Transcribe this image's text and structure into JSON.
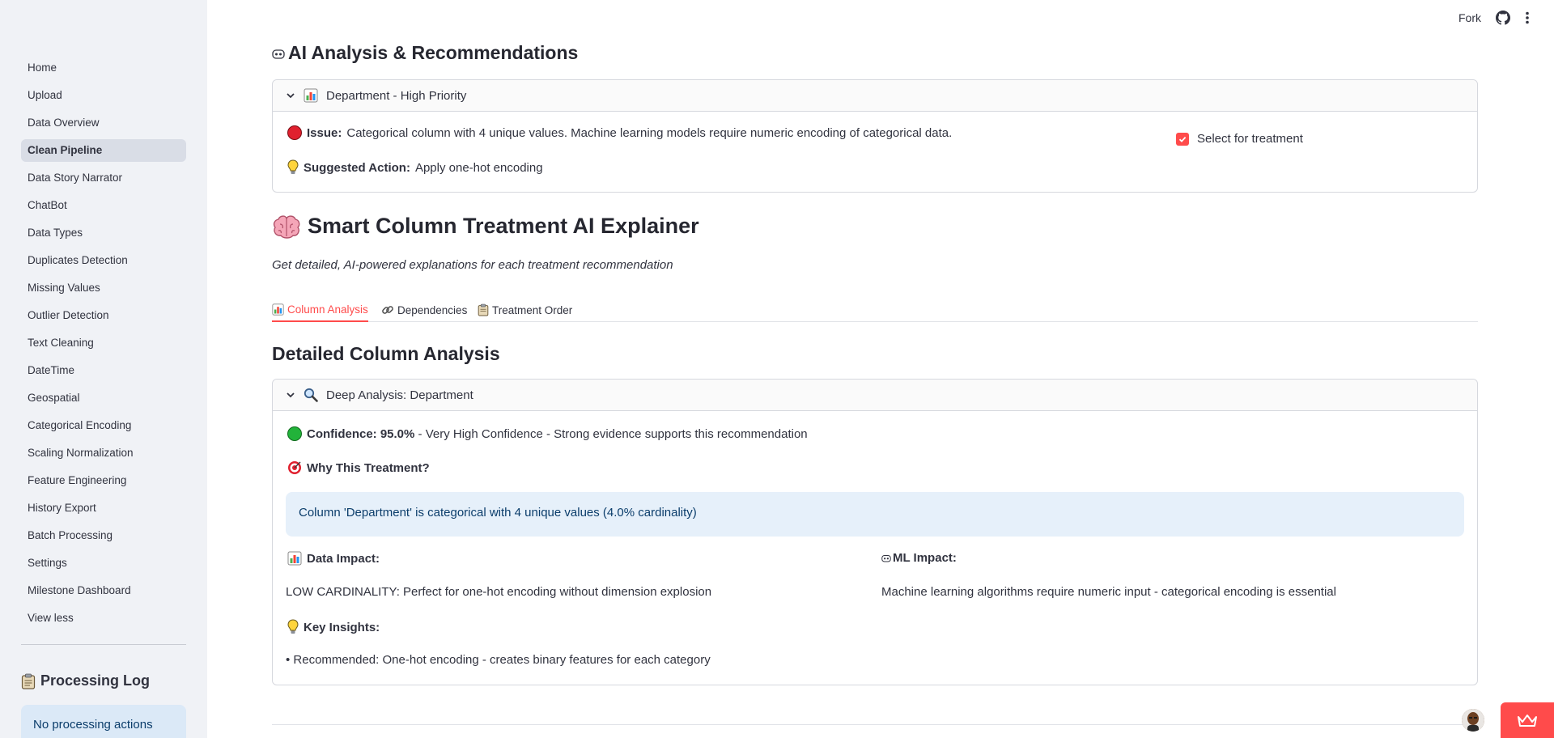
{
  "sidebar": {
    "items": [
      {
        "label": "Home"
      },
      {
        "label": "Upload"
      },
      {
        "label": "Data Overview"
      },
      {
        "label": "Clean Pipeline",
        "active": true
      },
      {
        "label": "Data Story Narrator"
      },
      {
        "label": "ChatBot"
      },
      {
        "label": "Data Types"
      },
      {
        "label": "Duplicates Detection"
      },
      {
        "label": "Missing Values"
      },
      {
        "label": "Outlier Detection"
      },
      {
        "label": "Text Cleaning"
      },
      {
        "label": "DateTime"
      },
      {
        "label": "Geospatial"
      },
      {
        "label": "Categorical Encoding"
      },
      {
        "label": "Scaling Normalization"
      },
      {
        "label": "Feature Engineering"
      },
      {
        "label": "History Export"
      },
      {
        "label": "Batch Processing"
      },
      {
        "label": "Settings"
      },
      {
        "label": "Milestone Dashboard"
      }
    ],
    "view_less": "View less",
    "processing_log": {
      "title": "Processing Log",
      "message": "No processing actions"
    }
  },
  "header": {
    "fork": "Fork"
  },
  "ai_analysis": {
    "title": "AI Analysis & Recommendations",
    "expander_title": "Department - High Priority",
    "issue_label": "Issue:",
    "issue_text": "Categorical column with 4 unique values. Machine learning models require numeric encoding of categorical data.",
    "action_label": "Suggested Action:",
    "action_text": "Apply one-hot encoding",
    "checkbox_label": "Select for treatment",
    "checkbox_checked": true
  },
  "explainer": {
    "title": "Smart Column Treatment AI Explainer",
    "subtitle": "Get detailed, AI-powered explanations for each treatment recommendation",
    "tabs": [
      {
        "label": "Column Analysis",
        "active": true
      },
      {
        "label": "Dependencies"
      },
      {
        "label": "Treatment Order"
      }
    ]
  },
  "detailed": {
    "title": "Detailed Column Analysis",
    "expander_title": "Deep Analysis: Department",
    "confidence_label": "Confidence: 95.0%",
    "confidence_text": " - Very High Confidence - Strong evidence supports this recommendation",
    "why_label": "Why This Treatment?",
    "why_text": "Column 'Department' is categorical with 4 unique values (4.0% cardinality)",
    "data_impact_label": "Data Impact:",
    "data_impact_text": "LOW CARDINALITY: Perfect for one-hot encoding without dimension explosion",
    "ml_impact_label": "ML Impact:",
    "ml_impact_text": "Machine learning algorithms require numeric input - categorical encoding is essential",
    "insights_label": "Key Insights:",
    "insights_text": "• Recommended: One-hot encoding - creates binary features for each category"
  },
  "colors": {
    "accent": "#ff4b4b",
    "sidebar_bg": "#f0f2f6",
    "info_bg": "#e6f0fa",
    "info_text": "#0b3d6b",
    "text": "#31333f"
  }
}
